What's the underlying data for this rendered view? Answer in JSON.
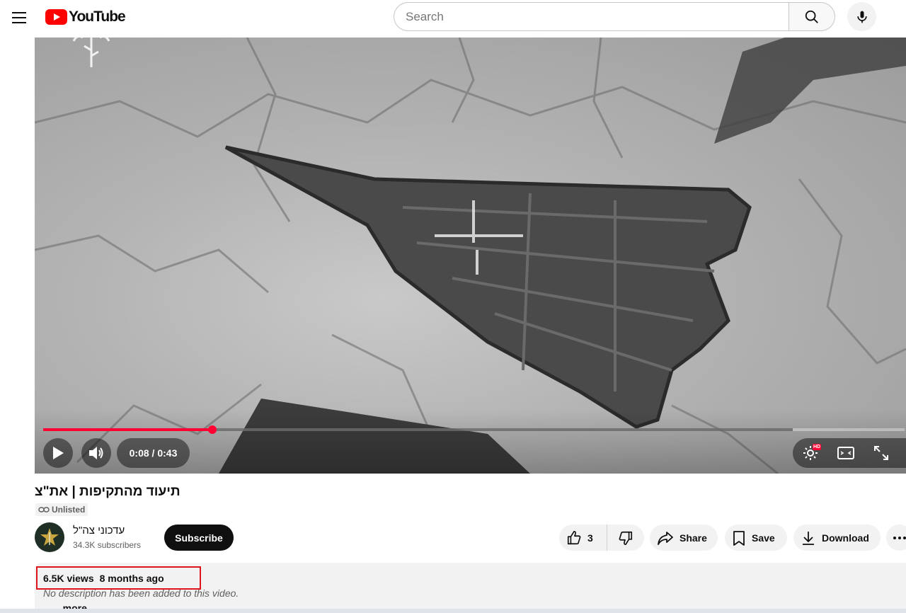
{
  "header": {
    "logo_text": "YouTube",
    "search_placeholder": "Search"
  },
  "player": {
    "current_time": "0:08",
    "duration": "0:43",
    "time_display": "0:08 / 0:43",
    "played_fraction": 0.196,
    "loaded_fraction": 0.87,
    "hd_badge": "HD",
    "accent_color": "#ff0033"
  },
  "video": {
    "title": "תיעוד מהתקיפות | את\"צ",
    "visibility": "Unlisted"
  },
  "channel": {
    "name": "עדכוני צה\"ל",
    "subscribers": "34.3K subscribers",
    "subscribe_label": "Subscribe"
  },
  "actions": {
    "like_count": "3",
    "share_label": "Share",
    "save_label": "Save",
    "download_label": "Download"
  },
  "description": {
    "views": "6.5K views",
    "age": "8 months ago",
    "text": "No description has been added to this video.",
    "more_label": "...more"
  },
  "highlight_color": "#e0151c"
}
